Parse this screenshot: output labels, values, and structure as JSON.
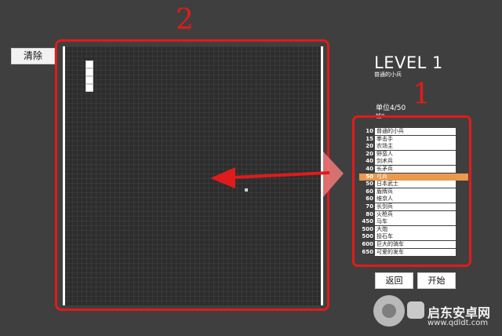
{
  "toolbar": {
    "clear_label": "清除"
  },
  "annotations": {
    "grid_number": "2",
    "list_number": "1"
  },
  "level": {
    "title": "LEVEL 1",
    "subtitle": "普通的小兵",
    "unit_count": "单位4/50",
    "money": "钱0"
  },
  "units": [
    {
      "cost": "10",
      "name": "普通的小兵"
    },
    {
      "cost": "15",
      "name": "拳击手"
    },
    {
      "cost": "20",
      "name": "农场主"
    },
    {
      "cost": "20",
      "name": "野蛮人"
    },
    {
      "cost": "40",
      "name": "剑术兵"
    },
    {
      "cost": "40",
      "name": "长矛兵"
    },
    {
      "cost": "50",
      "name": "弓兵"
    },
    {
      "cost": "50",
      "name": "日本武士"
    },
    {
      "cost": "60",
      "name": "盾牌兵"
    },
    {
      "cost": "60",
      "name": "维京人"
    },
    {
      "cost": "70",
      "name": "长剑兵"
    },
    {
      "cost": "80",
      "name": "火枪兵"
    },
    {
      "cost": "450",
      "name": "马车"
    },
    {
      "cost": "500",
      "name": "大炮"
    },
    {
      "cost": "500",
      "name": "投石车"
    },
    {
      "cost": "600",
      "name": "巨大的骑车"
    },
    {
      "cost": "650",
      "name": "可爱的发车"
    }
  ],
  "selected_index": 6,
  "buttons": {
    "back_label": "返回",
    "start_label": "开始"
  },
  "watermark": {
    "name": "启东安卓网",
    "url": "www.qdldt.com"
  },
  "colors": {
    "annotation_red": "#e01b1b",
    "selected_row": "#e89a4e",
    "board": "#2d2d2d",
    "background": "#3f3f3f"
  }
}
